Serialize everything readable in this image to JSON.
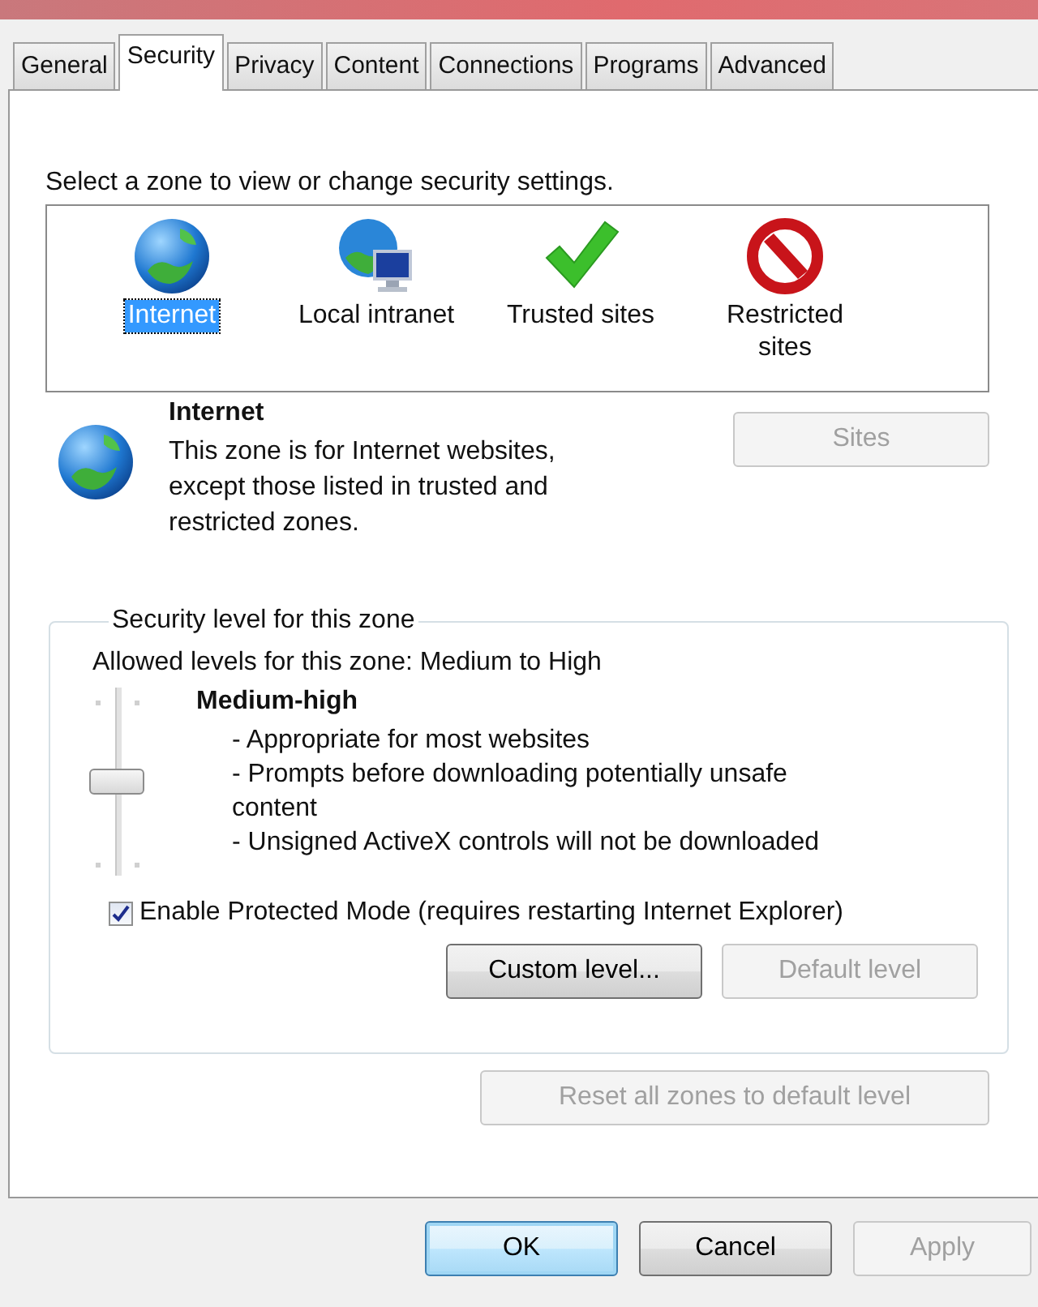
{
  "tabs": [
    {
      "label": "General",
      "selected": false
    },
    {
      "label": "Security",
      "selected": true
    },
    {
      "label": "Privacy",
      "selected": false
    },
    {
      "label": "Content",
      "selected": false
    },
    {
      "label": "Connections",
      "selected": false
    },
    {
      "label": "Programs",
      "selected": false
    },
    {
      "label": "Advanced",
      "selected": false
    }
  ],
  "zones": {
    "prompt": "Select a zone to view or change security settings.",
    "items": [
      {
        "label": "Internet",
        "kind": "globe",
        "selected": true
      },
      {
        "label": "Local intranet",
        "kind": "intranet",
        "selected": false
      },
      {
        "label": "Trusted sites",
        "kind": "check",
        "selected": false
      },
      {
        "label": "Restricted sites",
        "kind": "block",
        "selected": false
      }
    ]
  },
  "zone_info": {
    "title": "Internet",
    "description": "This zone is for Internet websites, except those listed in trusted and restricted zones.",
    "sites_button": {
      "label": "Sites",
      "disabled": true
    }
  },
  "security_level": {
    "legend": "Security level for this zone",
    "allowed": "Allowed levels for this zone: Medium to High",
    "slider": {
      "level": 0.5
    },
    "level_name": "Medium-high",
    "bullets": [
      "- Appropriate for most websites",
      "- Prompts before downloading potentially unsafe content",
      "- Unsigned ActiveX controls will not be downloaded"
    ],
    "protected_mode": {
      "label": "Enable Protected Mode (requires restarting Internet Explorer)",
      "checked": true
    },
    "buttons": [
      {
        "label": "Custom level...",
        "disabled": false
      },
      {
        "label": "Default level",
        "disabled": true
      }
    ]
  },
  "reset_button": {
    "label": "Reset all zones to default level",
    "disabled": true
  },
  "footer_buttons": [
    {
      "label": "OK",
      "disabled": false,
      "default": true
    },
    {
      "label": "Cancel",
      "disabled": false,
      "default": false
    },
    {
      "label": "Apply",
      "disabled": true,
      "default": false
    }
  ]
}
